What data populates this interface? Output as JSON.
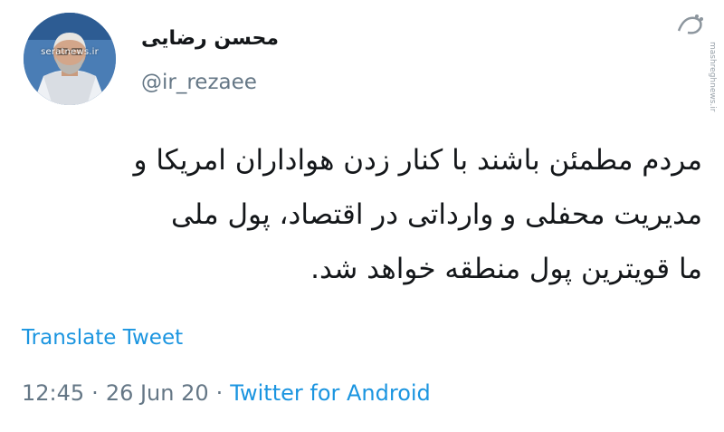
{
  "user": {
    "display_name": "محسن رضایی",
    "handle": "@ir_rezaee",
    "avatar_watermark": "seratnews.ir"
  },
  "tweet": {
    "lines": [
      "مردم مطمئن باشند با کنار زدن هواداران امریکا و",
      "مدیریت محفلی و وارداتی در اقتصاد، پول ملی",
      "ما قویترین پول منطقه خواهد شد."
    ]
  },
  "translate": {
    "label": "Translate Tweet"
  },
  "meta": {
    "time": "12:45",
    "separator": "·",
    "date": "26 Jun 20",
    "source": "Twitter for Android"
  },
  "watermark": {
    "site": "mashreghnews.ir"
  },
  "colors": {
    "link": "#1b95e0",
    "secondary_text": "#657786",
    "primary_text": "#14171a",
    "background": "#ffffff"
  }
}
